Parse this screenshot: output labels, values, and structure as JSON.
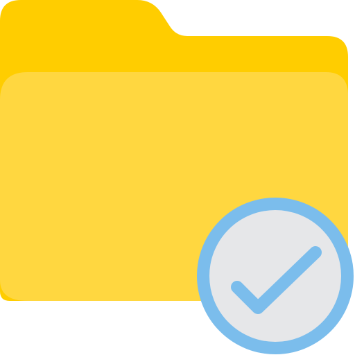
{
  "icon": {
    "name": "folder-check-icon",
    "badge": "check-badge",
    "colors": {
      "folder_back": "#FFCD00",
      "folder_front": "#FFD740",
      "badge_fill": "#E6E7E9",
      "badge_stroke": "#7BBDEC",
      "check_stroke": "#7BBDEC",
      "background": "#FFFFFF"
    }
  }
}
